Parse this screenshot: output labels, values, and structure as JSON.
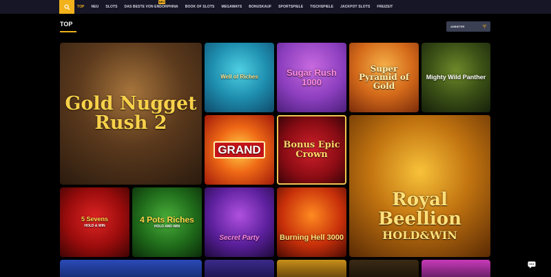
{
  "nav": {
    "items": [
      {
        "label": "TOP",
        "active": true
      },
      {
        "label": "NEU",
        "active": false
      },
      {
        "label": "SLOTS",
        "active": false
      },
      {
        "label": "DAS BESTE VON ENDORPHINA",
        "active": false
      },
      {
        "label": "BOOK OF SLOTS",
        "active": false
      },
      {
        "label": "MEGAWAYS",
        "active": false
      },
      {
        "label": "BONUSKAUF",
        "active": false
      },
      {
        "label": "SPORTSPIELE",
        "active": false
      },
      {
        "label": "TISCHSPIELE",
        "active": false
      },
      {
        "label": "JACKPOT SLOTS",
        "active": false
      },
      {
        "label": "FREIZEIT",
        "active": false
      }
    ],
    "new_badge": "NEU"
  },
  "section": {
    "title": "TOP",
    "provider_label": "ANBIETER"
  },
  "games": [
    {
      "title": "Gold Nugget Rush 2",
      "sub": ""
    },
    {
      "title": "Well of Riches",
      "sub": ""
    },
    {
      "title": "Sugar Rush 1000",
      "sub": ""
    },
    {
      "title": "Super Pyramid of Gold",
      "sub": ""
    },
    {
      "title": "Mighty Wild Panther",
      "sub": ""
    },
    {
      "title": "GRAND",
      "sub": ""
    },
    {
      "title": "Bonus Epic Crown",
      "sub": ""
    },
    {
      "title": "Royal Beellion",
      "sub": "HOLD&WIN"
    },
    {
      "title": "5 Sevens",
      "sub": "HOLD & WIN"
    },
    {
      "title": "4 Pots Riches",
      "sub": "HOLD AND WIN"
    },
    {
      "title": "Secret Party",
      "sub": ""
    },
    {
      "title": "Burning Hell 3000",
      "sub": ""
    }
  ],
  "colors": {
    "accent": "#f2b21c",
    "nav_bg": "#161626",
    "page_bg": "#000000",
    "select_bg": "#3b3f52"
  }
}
